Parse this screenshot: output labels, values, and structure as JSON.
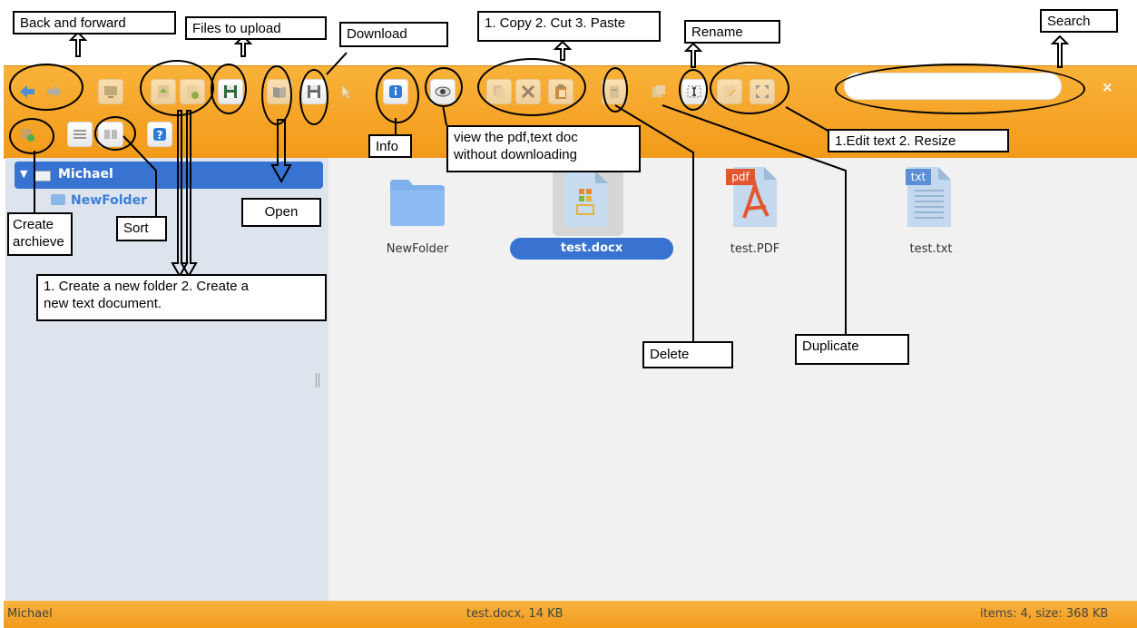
{
  "toolbar": {
    "buttons": [
      {
        "name": "back-button",
        "icon": "arrow-left-icon"
      },
      {
        "name": "forward-button",
        "icon": "arrow-right-icon"
      },
      {
        "name": "reload-button",
        "icon": "monitor-icon"
      },
      {
        "name": "upload-button",
        "icon": "upload-icon"
      },
      {
        "name": "new-doc-button",
        "icon": "new-file-icon"
      },
      {
        "name": "save-button",
        "icon": "floppy-icon"
      },
      {
        "name": "open-button",
        "icon": "book-icon"
      },
      {
        "name": "download-button",
        "icon": "floppy-icon"
      },
      {
        "name": "select-button",
        "icon": "cursor-icon"
      },
      {
        "name": "info-button",
        "icon": "info-icon"
      },
      {
        "name": "preview-button",
        "icon": "eye-icon"
      },
      {
        "name": "copy-button",
        "icon": "copy-icon"
      },
      {
        "name": "cut-button",
        "icon": "scissors-icon"
      },
      {
        "name": "paste-button",
        "icon": "clipboard-icon"
      },
      {
        "name": "delete-button",
        "icon": "trash-icon"
      },
      {
        "name": "duplicate-button",
        "icon": "duplicate-icon"
      },
      {
        "name": "rename-button",
        "icon": "text-cursor-icon"
      },
      {
        "name": "edit-button",
        "icon": "pencil-icon"
      },
      {
        "name": "resize-button",
        "icon": "resize-icon"
      },
      {
        "name": "archive-button",
        "icon": "archive-icon"
      },
      {
        "name": "view-button",
        "icon": "list-icon"
      },
      {
        "name": "sort-button",
        "icon": "sort-icon"
      },
      {
        "name": "help-button",
        "icon": "help-icon"
      }
    ],
    "search_value": "",
    "clear_label": "×"
  },
  "sidebar": {
    "root": "Michael",
    "child": "NewFolder"
  },
  "files": [
    {
      "name": "NewFolder",
      "type": "folder-icon"
    },
    {
      "name": "test.docx",
      "type": "docx-icon",
      "selected": true
    },
    {
      "name": "test.PDF",
      "type": "pdf-icon",
      "badge": "pdf"
    },
    {
      "name": "test.txt",
      "type": "txt-icon",
      "badge": "txt"
    }
  ],
  "status": {
    "left": "Michael",
    "center": "test.docx, 14 KB",
    "right": "items: 4, size: 368 KB"
  },
  "annotations": {
    "back_forward": "Back and forward",
    "files_upload": "Files to upload",
    "download": "Download",
    "copy_cut_paste": "1. Copy 2. Cut 3. Paste",
    "rename": "Rename",
    "search": "Search",
    "info": "Info",
    "view_pdf_line1": "view the pdf,text doc",
    "view_pdf_line2": "without downloading",
    "edit_resize": "1.Edit text 2. Resize",
    "open": "Open",
    "create_archive_line1": "Create",
    "create_archive_line2": "archieve",
    "sort": "Sort",
    "new_folder_line1": "1. Create a new folder 2. Create a",
    "new_folder_line2": "new text document.",
    "delete": "Delete",
    "duplicate": "Duplicate"
  },
  "colors": {
    "toolbar": "#f29a19",
    "selection": "#3873d2",
    "sidebar": "#dee4ee",
    "workspace": "#f1f1f1"
  }
}
